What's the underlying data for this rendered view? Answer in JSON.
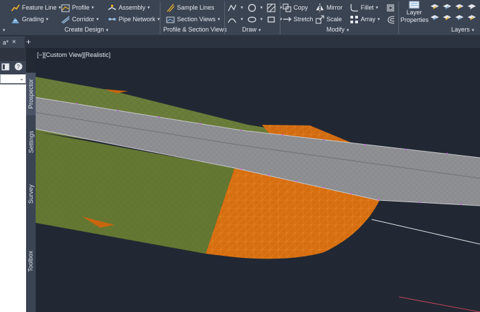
{
  "ribbon": {
    "create_design": {
      "title": "Create Design",
      "col1": [
        "Feature Line",
        "Grading"
      ],
      "col2": [
        "Profile",
        "Corridor"
      ],
      "col3": [
        "Assembly",
        "Pipe Network"
      ]
    },
    "profile_section": {
      "title": "Profile & Section Views",
      "items": [
        "Sample Lines",
        "Section Views"
      ]
    },
    "draw": {
      "title": "Draw"
    },
    "modify": {
      "title": "Modify",
      "col1": [
        "Copy",
        "Stretch"
      ],
      "col2": [
        "Mirror",
        "Scale"
      ],
      "col3": [
        "Fillet",
        "Array"
      ]
    },
    "layers": {
      "title": "Layers",
      "layer_properties": [
        "Layer",
        "Properties"
      ]
    }
  },
  "tabbar": {
    "doc_tab": "a*",
    "close": "×",
    "add": "+"
  },
  "viewport": {
    "label": "[−][Custom View][Realistic]"
  },
  "side_tabs": [
    "Prospector",
    "Settings",
    "Survey",
    "Toolbox"
  ],
  "colors": {
    "ribbon_bg": "#3b4453",
    "viewport_bg": "#212833",
    "surface_green": "#667a33",
    "corridor_gray": "#8c8e92",
    "grading_orange": "#d66d0f"
  }
}
